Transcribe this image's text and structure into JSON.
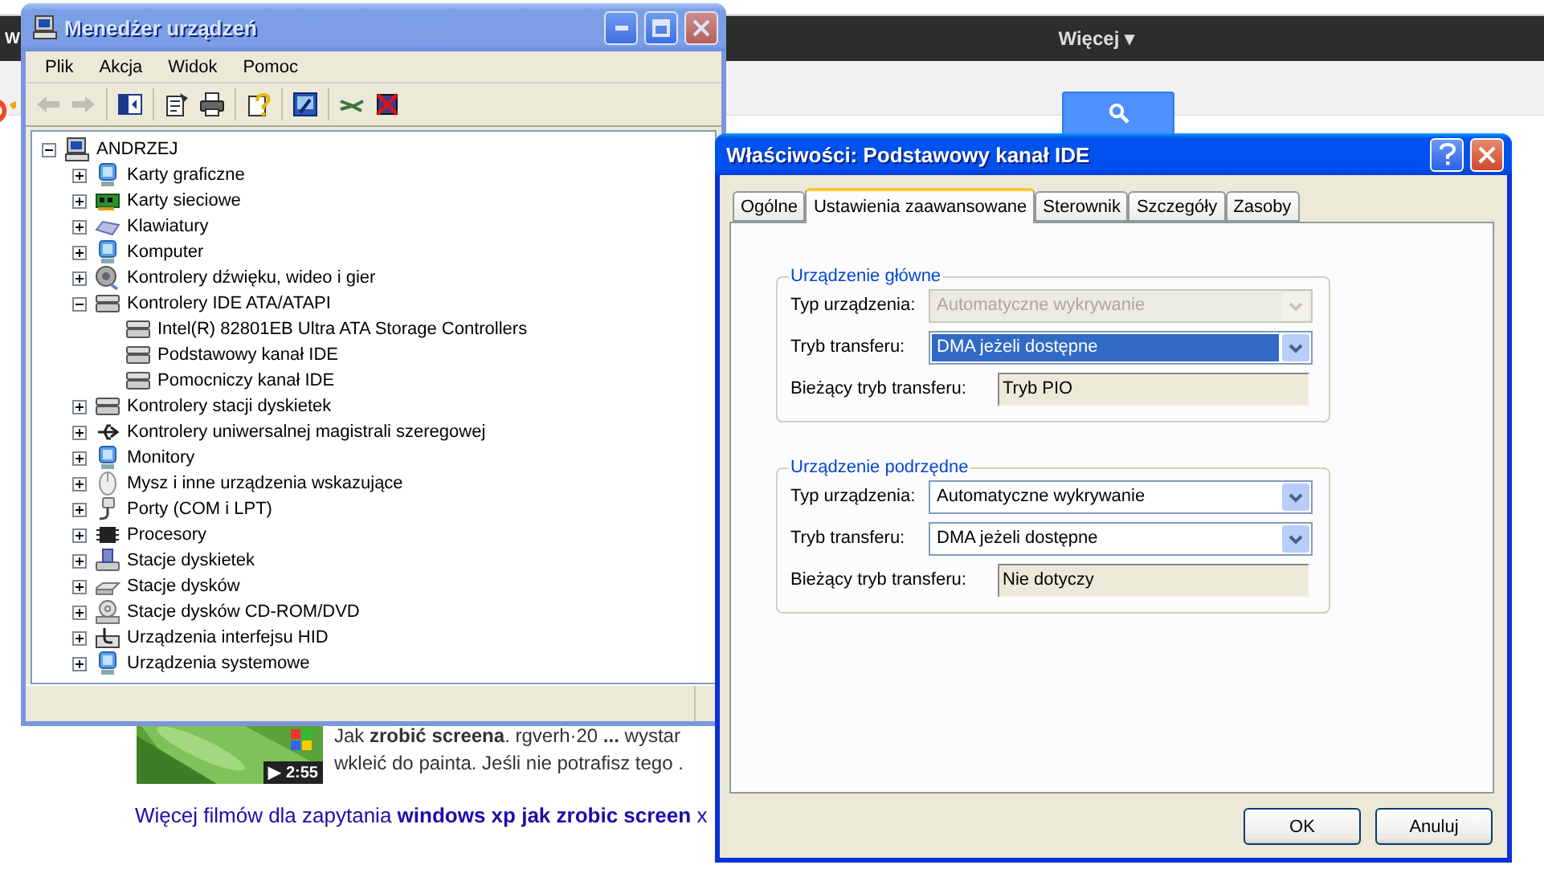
{
  "browser": {
    "nav_letter": "W",
    "more_menu": "Więcej ▾",
    "results": {
      "video_duration": "▶ 2:55",
      "snippet_lines": [
        "Jak **zrobić screena**. rgverh·20 **...** wystar",
        "wkleić do painta. Jeśli nie potrafisz tego ."
      ],
      "more_videos": "Więcej filmów dla zapytania **windows xp jak zrobic screen** x"
    }
  },
  "device_manager": {
    "title": "Menedżer urządzeń",
    "active": false,
    "menu": [
      "Plik",
      "Akcja",
      "Widok",
      "Pomoc"
    ],
    "toolbar": [
      {
        "kind": "back",
        "disabled": true
      },
      {
        "kind": "forward",
        "disabled": true
      },
      {
        "kind": "sep"
      },
      {
        "kind": "tree",
        "disabled": false
      },
      {
        "kind": "sep"
      },
      {
        "kind": "properties",
        "disabled": false
      },
      {
        "kind": "print",
        "disabled": false
      },
      {
        "kind": "sep"
      },
      {
        "kind": "help",
        "disabled": false
      },
      {
        "kind": "sep"
      },
      {
        "kind": "scan",
        "disabled": false
      },
      {
        "kind": "sep"
      },
      {
        "kind": "update",
        "disabled": false
      },
      {
        "kind": "uninstall",
        "disabled": false
      }
    ],
    "tree": {
      "label": "ANDRZEJ",
      "kind": "computer",
      "expanded": true,
      "children": [
        {
          "label": "Karty graficzne",
          "kind": "monitor",
          "expanded": false
        },
        {
          "label": "Karty sieciowe",
          "kind": "card",
          "expanded": false
        },
        {
          "label": "Klawiatury",
          "kind": "keyboard",
          "expanded": false
        },
        {
          "label": "Komputer",
          "kind": "monitor",
          "expanded": false
        },
        {
          "label": "Kontrolery dźwięku, wideo i gier",
          "kind": "speaker",
          "expanded": false
        },
        {
          "label": "Kontrolery IDE ATA/ATAPI",
          "kind": "controller",
          "expanded": true,
          "children": [
            {
              "label": "Intel(R) 82801EB Ultra ATA Storage Controllers",
              "kind": "controller"
            },
            {
              "label": "Podstawowy kanał IDE",
              "kind": "controller"
            },
            {
              "label": "Pomocniczy kanał IDE",
              "kind": "controller"
            }
          ]
        },
        {
          "label": "Kontrolery stacji dyskietek",
          "kind": "controller",
          "expanded": false
        },
        {
          "label": "Kontrolery uniwersalnej magistrali szeregowej",
          "kind": "usb",
          "expanded": false
        },
        {
          "label": "Monitory",
          "kind": "monitor",
          "expanded": false
        },
        {
          "label": "Mysz i inne urządzenia wskazujące",
          "kind": "mouse",
          "expanded": false
        },
        {
          "label": "Porty (COM i LPT)",
          "kind": "plug",
          "expanded": false
        },
        {
          "label": "Procesory",
          "kind": "chip",
          "expanded": false
        },
        {
          "label": "Stacje dyskietek",
          "kind": "floppy",
          "expanded": false
        },
        {
          "label": "Stacje dysków",
          "kind": "disk",
          "expanded": false
        },
        {
          "label": "Stacje dysków CD-ROM/DVD",
          "kind": "cd",
          "expanded": false
        },
        {
          "label": "Urządzenia interfejsu HID",
          "kind": "hid",
          "expanded": false
        },
        {
          "label": "Urządzenia systemowe",
          "kind": "monitor",
          "expanded": false
        }
      ]
    }
  },
  "properties_dialog": {
    "title": "Właściwości: Podstawowy kanał IDE",
    "active": true,
    "tabs": [
      {
        "label": "Ogólne",
        "selected": false
      },
      {
        "label": "Ustawienia zaawansowane",
        "selected": true
      },
      {
        "label": "Sterownik",
        "selected": false
      },
      {
        "label": "Szczegóły",
        "selected": false
      },
      {
        "label": "Zasoby",
        "selected": false
      }
    ],
    "groups": [
      {
        "title": "Urządzenie główne",
        "rows": [
          {
            "kind": "dropdown",
            "label": "Typ urządzenia:",
            "value": "Automatyczne wykrywanie",
            "disabled": true,
            "focused": false
          },
          {
            "kind": "dropdown",
            "label": "Tryb transferu:",
            "value": "DMA jeżeli dostępne",
            "disabled": false,
            "focused": true
          },
          {
            "kind": "readout",
            "label": "Bieżący tryb transferu:",
            "value": "Tryb PIO"
          }
        ]
      },
      {
        "title": "Urządzenie podrzędne",
        "rows": [
          {
            "kind": "dropdown",
            "label": "Typ urządzenia:",
            "value": "Automatyczne wykrywanie",
            "disabled": false,
            "focused": false
          },
          {
            "kind": "dropdown",
            "label": "Tryb transferu:",
            "value": "DMA jeżeli dostępne",
            "disabled": false,
            "focused": false
          },
          {
            "kind": "readout",
            "label": "Bieżący tryb transferu:",
            "value": "Nie dotyczy"
          }
        ]
      }
    ],
    "buttons": [
      "OK",
      "Anuluj"
    ]
  }
}
